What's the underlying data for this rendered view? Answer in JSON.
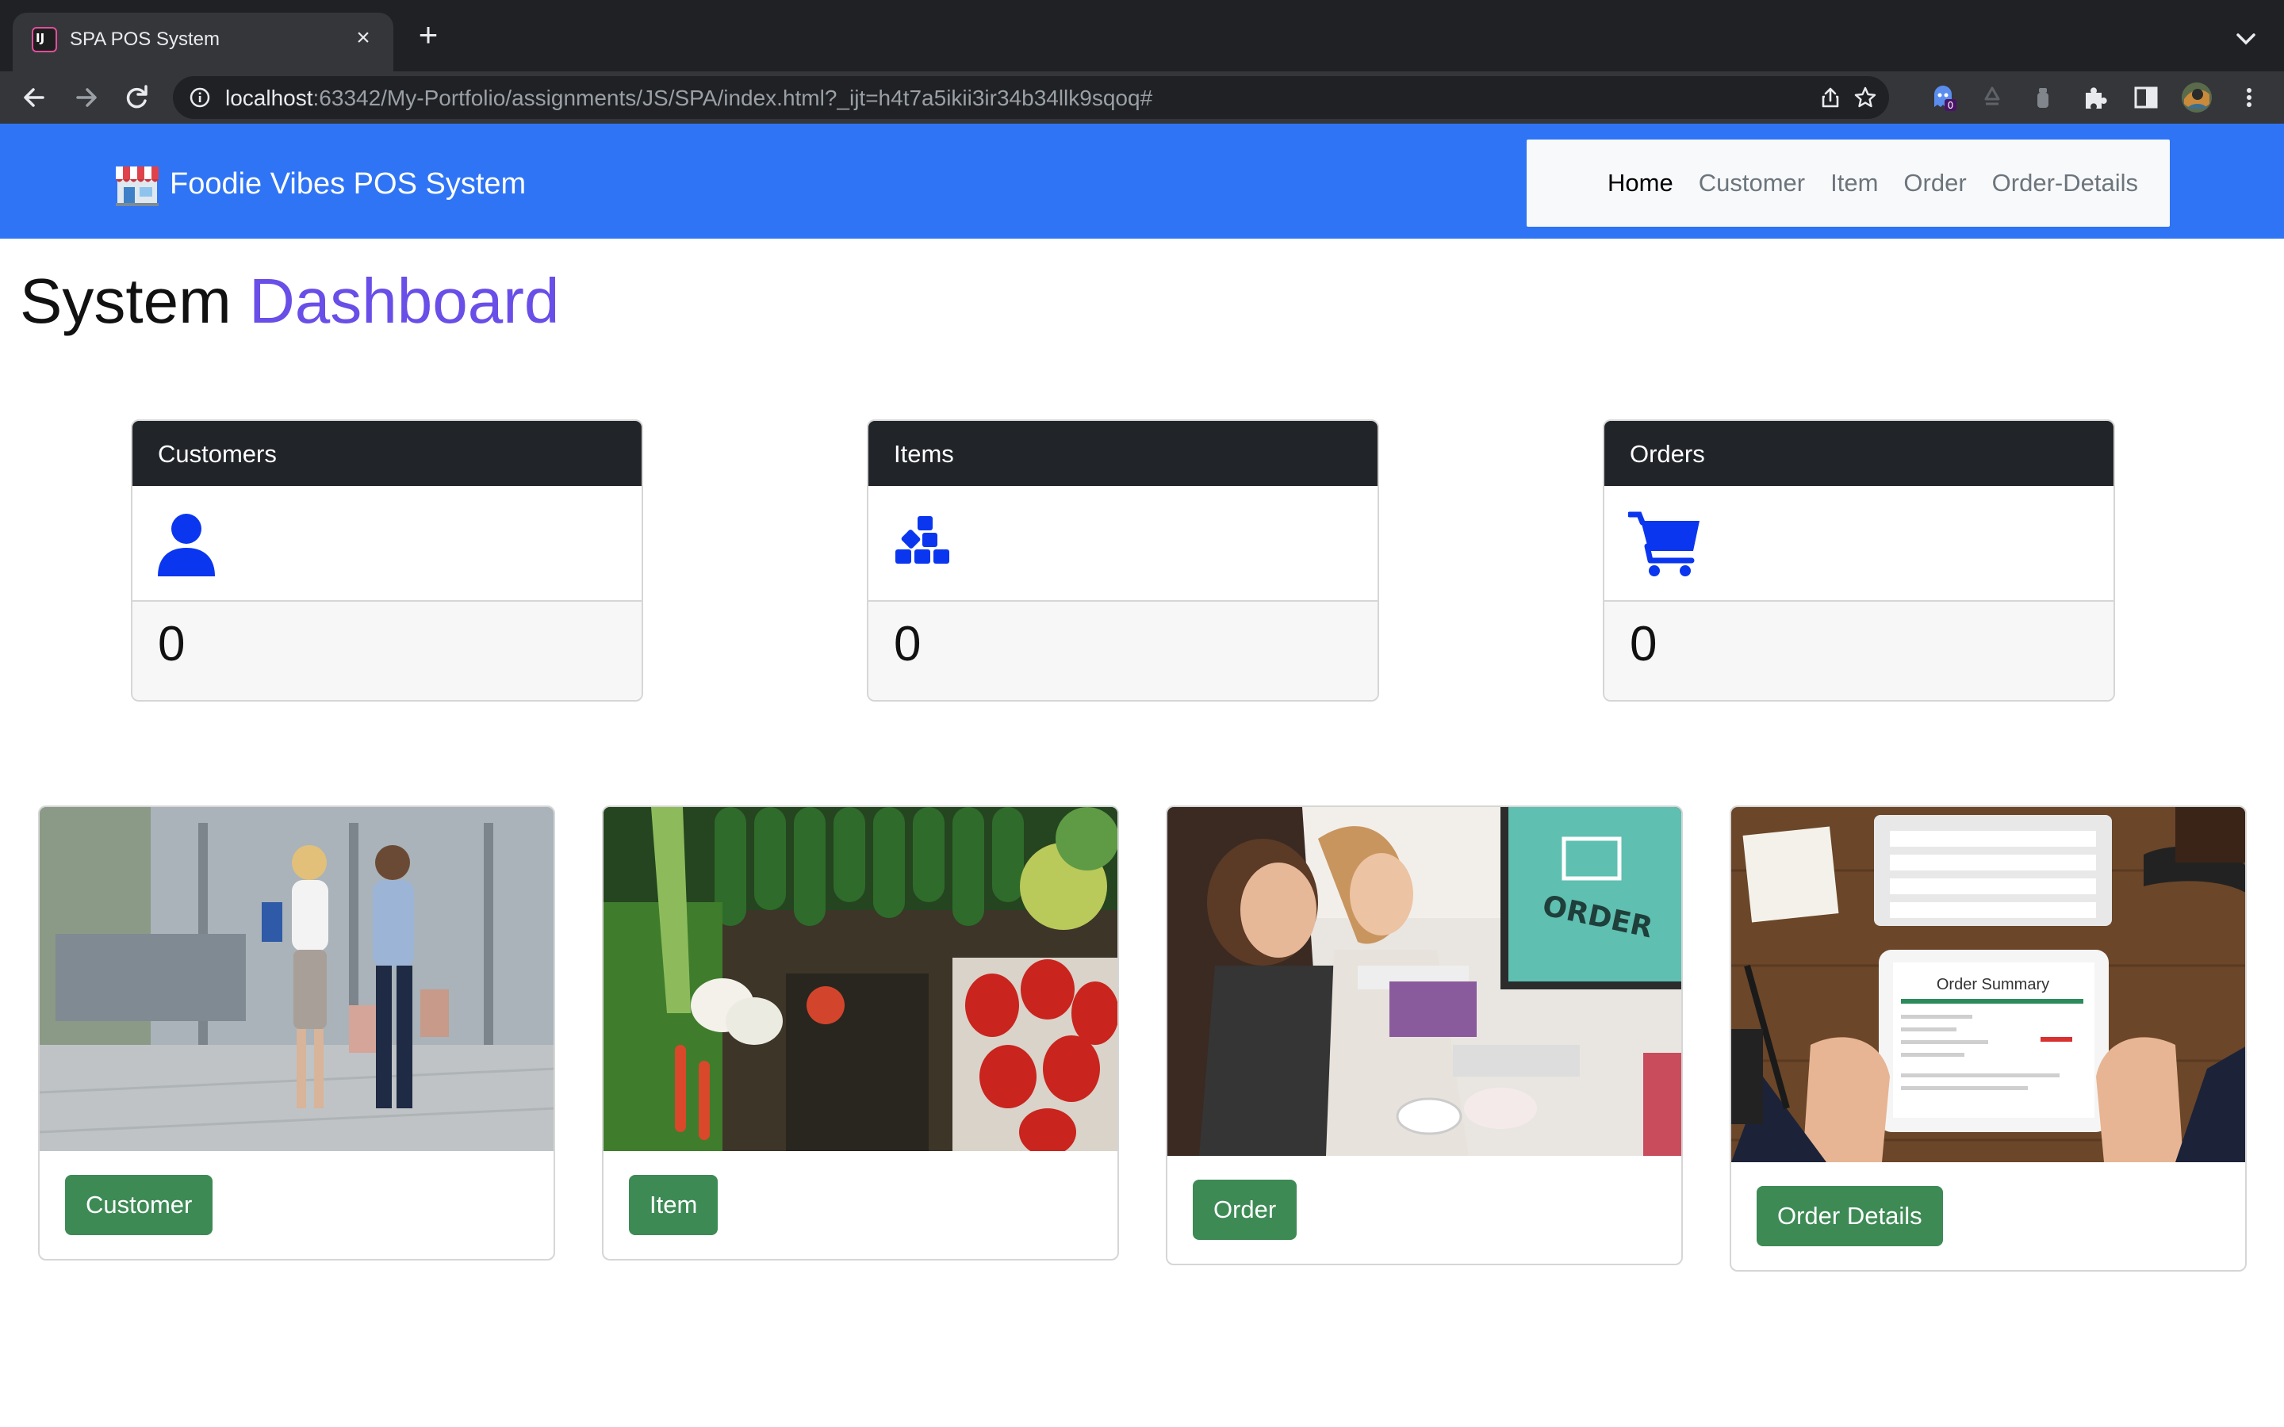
{
  "browser": {
    "tab_title": "SPA POS System",
    "url_host": "localhost",
    "url_rest": ":63342/My-Portfolio/assignments/JS/SPA/index.html?_ijt=h4t7a5ikii3ir34b34llk9sqoq#",
    "extension_badge": "0",
    "icons": [
      "back-arrow-icon",
      "forward-arrow-icon",
      "reload-icon",
      "info-icon",
      "share-icon",
      "star-icon",
      "extension-icon",
      "puzzle-icon",
      "side-panel-icon",
      "profile-avatar"
    ]
  },
  "navbar": {
    "brand": "Foodie Vibes POS System",
    "brand_icon": "shop-icon",
    "links": [
      {
        "label": "Home",
        "active": true
      },
      {
        "label": "Customer",
        "active": false
      },
      {
        "label": "Item",
        "active": false
      },
      {
        "label": "Order",
        "active": false
      },
      {
        "label": "Order-Details",
        "active": false
      }
    ],
    "background": "#2f74f5"
  },
  "heading": {
    "part1": "System",
    "part2": "Dashboard",
    "accent_color": "#6a4ee8"
  },
  "stats": [
    {
      "title": "Customers",
      "icon": "user-icon",
      "value": "0"
    },
    {
      "title": "Items",
      "icon": "cubes-icon",
      "value": "0"
    },
    {
      "title": "Orders",
      "icon": "cart-icon",
      "value": "0"
    }
  ],
  "cards": [
    {
      "image": "shoppers-photo",
      "button": "Customer"
    },
    {
      "image": "vegetables-photo",
      "button": "Item"
    },
    {
      "image": "online-order-photo",
      "button": "Order"
    },
    {
      "image": "order-summary-photo",
      "button": "Order Details"
    }
  ],
  "colors": {
    "button_green": "#3d8a55",
    "icon_blue": "#0b36f0",
    "card_header": "#212529"
  }
}
